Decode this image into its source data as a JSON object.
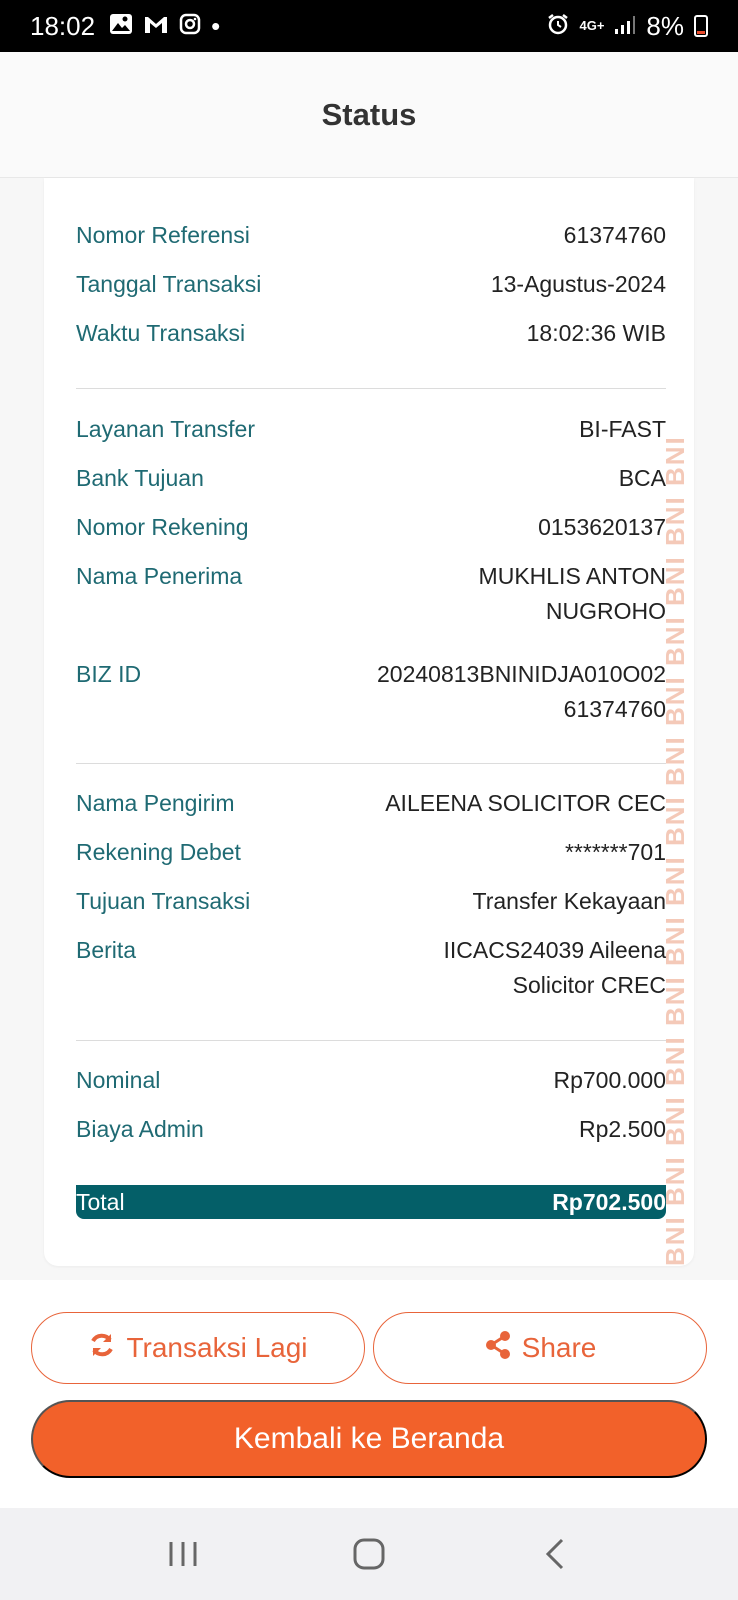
{
  "status_bar": {
    "time": "18:02",
    "network": "4G+",
    "battery": "8%",
    "notification_dot": "•"
  },
  "header": {
    "title": "Status"
  },
  "watermark": "BNI BNI BNI BNI BNI BNI BNI BNI BNI BNI BNI BNI BNI BNI",
  "section1": {
    "nomor_referensi": {
      "label": "Nomor Referensi",
      "value": "61374760"
    },
    "tanggal_transaksi": {
      "label": "Tanggal Transaksi",
      "value": "13-Agustus-2024"
    },
    "waktu_transaksi": {
      "label": "Waktu Transaksi",
      "value": "18:02:36 WIB"
    }
  },
  "section2": {
    "layanan_transfer": {
      "label": "Layanan Transfer",
      "value": "BI-FAST"
    },
    "bank_tujuan": {
      "label": "Bank Tujuan",
      "value": "BCA"
    },
    "nomor_rekening": {
      "label": "Nomor Rekening",
      "value": "0153620137"
    },
    "nama_penerima": {
      "label": "Nama Penerima",
      "value": "MUKHLIS ANTON NUGROHO"
    },
    "biz_id": {
      "label": "BIZ ID",
      "value": "20240813BNINIDJA010O02 61374760"
    }
  },
  "section3": {
    "nama_pengirim": {
      "label": "Nama Pengirim",
      "value": "AILEENA SOLICITOR CEC"
    },
    "rekening_debet": {
      "label": "Rekening Debet",
      "value": "*******701"
    },
    "tujuan_transaksi": {
      "label": "Tujuan Transaksi",
      "value": "Transfer Kekayaan"
    },
    "berita": {
      "label": "Berita",
      "value": "IICACS24039 Aileena Solicitor CREC"
    }
  },
  "section4": {
    "nominal": {
      "label": "Nominal",
      "value": "Rp700.000"
    },
    "biaya_admin": {
      "label": "Biaya Admin",
      "value": "Rp2.500"
    },
    "total": {
      "label": "Total",
      "value": "Rp702.500"
    }
  },
  "buttons": {
    "transaksi_lagi": "Transaksi Lagi",
    "share": "Share",
    "kembali": "Kembali ke Beranda"
  },
  "colors": {
    "accent": "#f2612a",
    "label_teal": "#1f6a73",
    "total_bg": "#045f68"
  }
}
